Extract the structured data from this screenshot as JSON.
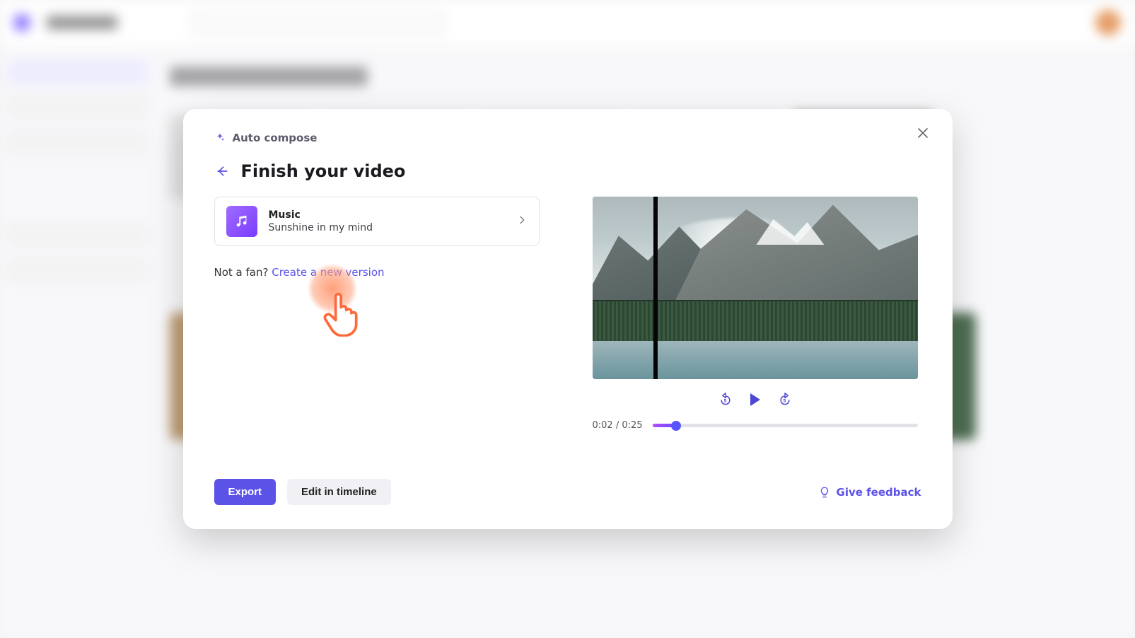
{
  "modal": {
    "auto_compose_label": "Auto compose",
    "title": "Finish your video",
    "music": {
      "heading": "Music",
      "track": "Sunshine in my mind"
    },
    "not_fan_text": "Not a fan? ",
    "new_version_link": "Create a new version",
    "export_label": "Export",
    "edit_label": "Edit in timeline",
    "feedback_label": "Give feedback"
  },
  "player": {
    "current_time": "0:02",
    "total_time": "0:25",
    "progress_pct": 9
  }
}
